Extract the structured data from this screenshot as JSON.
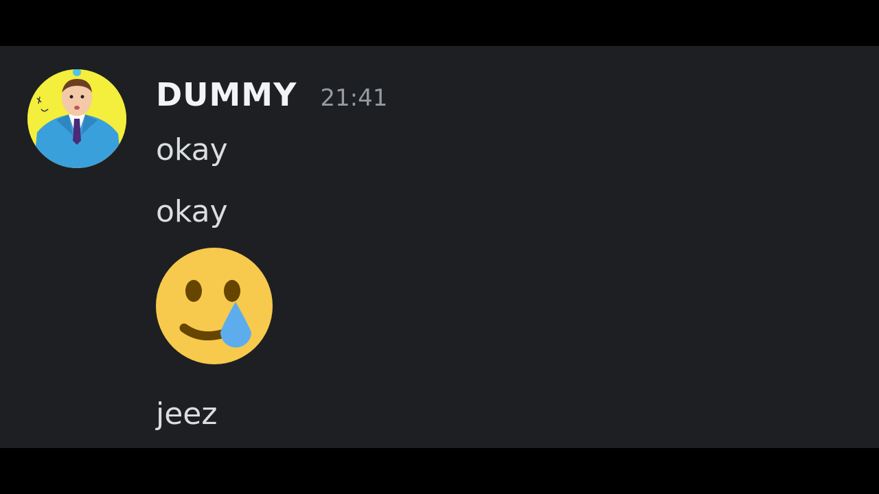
{
  "message_group": {
    "username": "DUMMY",
    "timestamp": "21:41",
    "avatar_icon": "cartoon-man-in-blue-suit-avatar",
    "messages": [
      {
        "type": "text",
        "content": "okay"
      },
      {
        "type": "text",
        "content": "okay"
      },
      {
        "type": "emoji",
        "icon": "smiling-face-with-tear-icon"
      },
      {
        "type": "text",
        "content": "jeez"
      }
    ]
  },
  "colors": {
    "background": "#1e1f22",
    "letterbox": "#000000",
    "username": "#f2f3f5",
    "timestamp": "#949ba4",
    "message_text": "#dbdee1",
    "emoji_face": "#f7c94d",
    "emoji_tear": "#5dadec"
  }
}
